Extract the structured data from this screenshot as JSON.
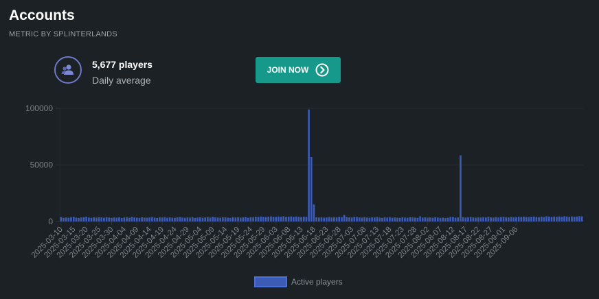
{
  "header": {
    "title": "Accounts",
    "subtitle": "METRIC BY SPLINTERLANDS"
  },
  "stat": {
    "icon": "players-icon",
    "value": "5,677 players",
    "label": "Daily average"
  },
  "join_button": {
    "label": "JOIN NOW",
    "icon": "chevron-right-circle-icon"
  },
  "colors": {
    "background": "#1c2125",
    "bar_fill": "#3c5bb5",
    "bar_stroke": "#4a6fd6",
    "button": "#16988a",
    "icon_ring": "#6e79c9"
  },
  "chart_data": {
    "type": "bar",
    "ylim": [
      0,
      100000
    ],
    "yticks": [
      0,
      50000,
      100000
    ],
    "ytick_labels": [
      "0",
      "50000",
      "100000"
    ],
    "grid": true,
    "legend_position": "bottom",
    "series": [
      {
        "name": "Active players",
        "start_date": "2025-03-10",
        "values": [
          4000,
          3200,
          3500,
          3300,
          3700,
          4200,
          3400,
          3100,
          3600,
          3900,
          4300,
          3500,
          3200,
          3700,
          3400,
          3800,
          3600,
          3300,
          3900,
          3500,
          3200,
          3600,
          3400,
          3800,
          3100,
          3500,
          3700,
          3300,
          4200,
          3600,
          3400,
          3200,
          3800,
          3500,
          3300,
          3600,
          3900,
          3400,
          3100,
          3700,
          3500,
          3800,
          3300,
          3600,
          3400,
          3200,
          3700,
          3900,
          3500,
          3300,
          3600,
          3400,
          3800,
          3200,
          3500,
          3700,
          3300,
          3600,
          3900,
          3400,
          4200,
          3700,
          3500,
          3300,
          3800,
          3600,
          3400,
          3200,
          3700,
          3500,
          3800,
          3400,
          3600,
          4100,
          3300,
          3900,
          3700,
          4300,
          4100,
          4400,
          4200,
          4000,
          4300,
          4500,
          4200,
          4100,
          4400,
          4300,
          4600,
          4200,
          4300,
          4500,
          4100,
          4400,
          4200,
          4000,
          4300,
          4200,
          99000,
          57000,
          15000,
          3800,
          3500,
          3700,
          3400,
          3600,
          3900,
          3500,
          3800,
          3600,
          4200,
          3900,
          5800,
          4100,
          3700,
          3500,
          4200,
          3900,
          3600,
          3400,
          3800,
          3500,
          3300,
          3700,
          3600,
          3900,
          3400,
          3200,
          3700,
          3500,
          3800,
          3300,
          3600,
          3400,
          3200,
          3700,
          3500,
          3300,
          3800,
          3600,
          3400,
          3200,
          4600,
          3500,
          3700,
          3400,
          3600,
          3300,
          3800,
          3500,
          3200,
          3400,
          3000,
          3300,
          4000,
          4200,
          3400,
          3600,
          58500,
          3800,
          3500,
          3700,
          3900,
          3600,
          3400,
          3700,
          3500,
          3800,
          3600,
          4000,
          3700,
          3500,
          3800,
          3600,
          3900,
          4100,
          3800,
          3600,
          4000,
          3700,
          3900,
          4200,
          4100,
          4300,
          4000,
          3800,
          4200,
          4400,
          4100,
          3900,
          4300,
          4000,
          4600,
          4300,
          4100,
          4400,
          4200,
          4500,
          4300,
          4600,
          4400,
          4200,
          4500,
          4300,
          4400,
          4700,
          4500
        ]
      }
    ],
    "xtick_labels": [
      "2025-03-10",
      "2025-03-15",
      "2025-03-20",
      "2025-03-25",
      "2025-03-30",
      "2025-04-04",
      "2025-04-09",
      "2025-04-14",
      "2025-04-19",
      "2025-04-24",
      "2025-04-29",
      "2025-05-04",
      "2025-05-09",
      "2025-05-14",
      "2025-05-19",
      "2025-05-24",
      "2025-05-29",
      "2025-06-03",
      "2025-06-08",
      "2025-06-13",
      "2025-06-18",
      "2025-06-23",
      "2025-06-28",
      "2025-07-03",
      "2025-07-08",
      "2025-07-13",
      "2025-07-18",
      "2025-07-23",
      "2025-07-28",
      "2025-08-02",
      "2025-08-07",
      "2025-08-12",
      "2025-08-17",
      "2025-08-22",
      "2025-08-27",
      "2025-09-01",
      "2025-09-06"
    ]
  }
}
